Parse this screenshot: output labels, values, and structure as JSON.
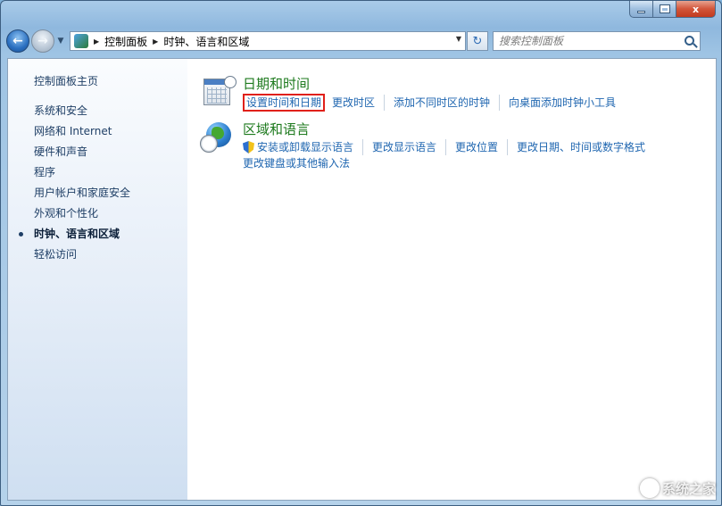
{
  "window": {
    "buttons": {
      "minimize": "minimize-icon",
      "maximize": "maximize-icon",
      "close": "close-icon",
      "close_glyph": "x"
    }
  },
  "navbar": {
    "back_glyph": "←",
    "forward_glyph": "→",
    "recent_glyph": "▼",
    "breadcrumb": [
      "控制面板",
      "时钟、语言和区域"
    ],
    "separator": "▶",
    "dropdown_glyph": "▼",
    "refresh_glyph": "↻",
    "search_placeholder": "搜索控制面板"
  },
  "sidebar": {
    "home": "控制面板主页",
    "items": [
      {
        "label": "系统和安全"
      },
      {
        "label": "网络和 Internet"
      },
      {
        "label": "硬件和声音"
      },
      {
        "label": "程序"
      },
      {
        "label": "用户帐户和家庭安全"
      },
      {
        "label": "外观和个性化"
      },
      {
        "label": "时钟、语言和区域",
        "current": true
      },
      {
        "label": "轻松访问"
      }
    ]
  },
  "categories": {
    "datetime": {
      "title": "日期和时间",
      "icon": "calendar-clock-icon",
      "links": [
        "设置时间和日期",
        "更改时区",
        "添加不同时区的时钟",
        "向桌面添加时钟小工具"
      ]
    },
    "region": {
      "title": "区域和语言",
      "icon": "globe-clock-icon",
      "links": [
        "安装或卸载显示语言",
        "更改显示语言",
        "更改位置",
        "更改日期、时间或数字格式",
        "更改键盘或其他输入法"
      ]
    }
  },
  "colors": {
    "highlight": "#e0201a",
    "link": "#1f66b0",
    "category_title": "#1e7a1e"
  },
  "watermark": {
    "text": "系统之家"
  }
}
